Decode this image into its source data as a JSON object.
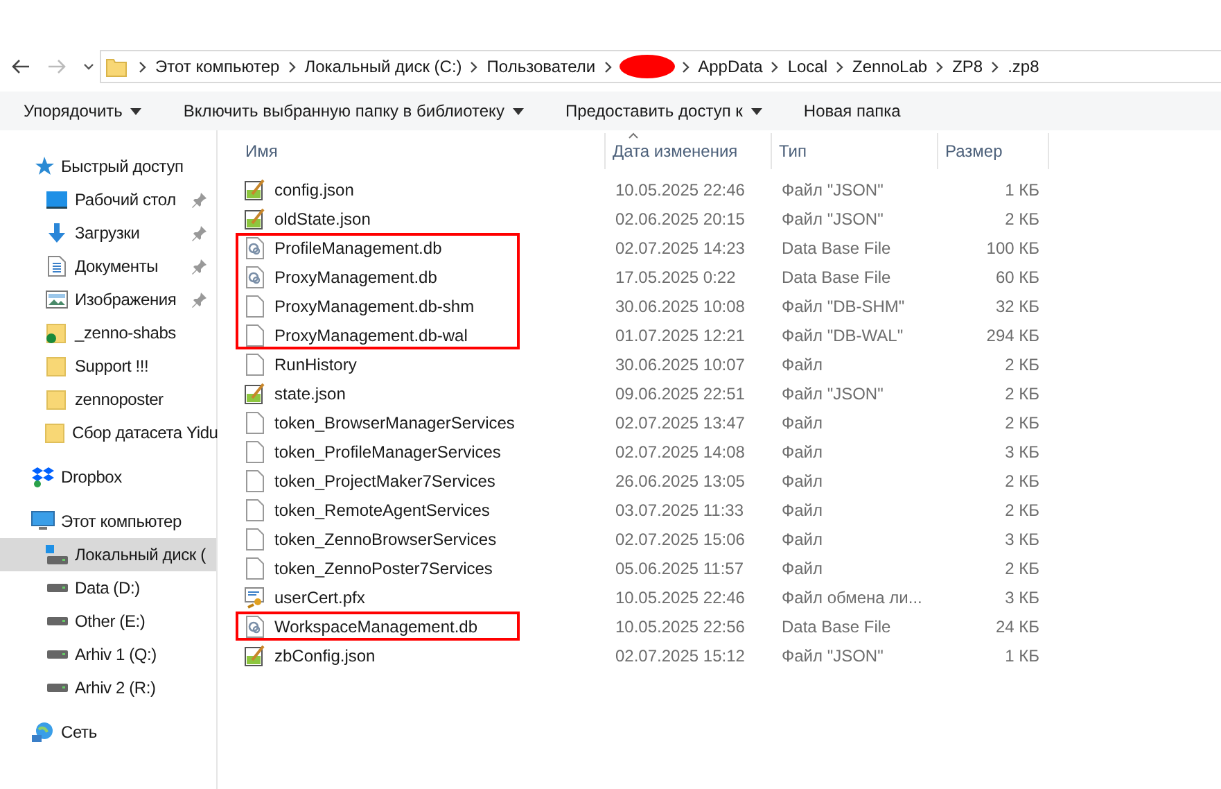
{
  "address_bar": {
    "segments": [
      "Этот компьютер",
      "Локальный диск (C:)",
      "Пользователи",
      {
        "kind": "redacted"
      },
      "AppData",
      "Local",
      "ZennoLab",
      "ZP8",
      ".zp8"
    ]
  },
  "toolbar": [
    {
      "label": "Упорядочить",
      "dropdown": true
    },
    {
      "label": "Включить выбранную папку в библиотеку",
      "dropdown": true
    },
    {
      "label": "Предоставить доступ к",
      "dropdown": true
    },
    {
      "label": "Новая папка",
      "dropdown": false
    }
  ],
  "sidebar": {
    "items": [
      {
        "label": "Быстрый доступ",
        "kind": "star",
        "selected": false,
        "children": [
          {
            "label": "Рабочий стол",
            "kind": "desktop",
            "pinned": true,
            "selected": false
          },
          {
            "label": "Загрузки",
            "kind": "download",
            "pinned": true,
            "selected": false
          },
          {
            "label": "Документы",
            "kind": "document",
            "pinned": true,
            "selected": false
          },
          {
            "label": "Изображения",
            "kind": "pictures",
            "pinned": true,
            "selected": false
          },
          {
            "label": "_zenno-shabs",
            "kind": "synced",
            "pinned": false,
            "selected": false
          },
          {
            "label": "Support !!!",
            "kind": "folder",
            "pinned": false,
            "selected": false
          },
          {
            "label": "zennoposter",
            "kind": "folder",
            "pinned": false,
            "selected": false
          },
          {
            "label": "Сбор датасета Yidu",
            "kind": "folder",
            "pinned": false,
            "selected": false
          }
        ]
      },
      {
        "label": "Dropbox",
        "kind": "dropbox",
        "selected": false
      },
      {
        "label": "Этот компьютер",
        "kind": "computer",
        "selected": false,
        "children": [
          {
            "label": "Локальный диск (",
            "kind": "system",
            "selected": true
          },
          {
            "label": "Data (D:)",
            "kind": "drive",
            "selected": false
          },
          {
            "label": "Other (E:)",
            "kind": "drive",
            "selected": false
          },
          {
            "label": "Arhiv 1 (Q:)",
            "kind": "drive",
            "selected": false
          },
          {
            "label": "Arhiv 2 (R:)",
            "kind": "drive",
            "selected": false
          }
        ]
      },
      {
        "label": "Сеть",
        "kind": "network",
        "selected": false
      }
    ]
  },
  "table": {
    "columns": [
      "Имя",
      "Дата изменения",
      "Тип",
      "Размер"
    ],
    "rows": [
      {
        "name": "config.json",
        "kind": "json",
        "date": "10.05.2025 22:46",
        "type": "Файл \"JSON\"",
        "size": "1 КБ",
        "highlighted": false
      },
      {
        "name": "oldState.json",
        "kind": "json",
        "date": "02.06.2025 20:15",
        "type": "Файл \"JSON\"",
        "size": "2 КБ",
        "highlighted": false
      },
      {
        "name": "ProfileManagement.db",
        "kind": "db",
        "date": "02.07.2025 14:23",
        "type": "Data Base File",
        "size": "100 КБ",
        "highlighted": true
      },
      {
        "name": "ProxyManagement.db",
        "kind": "db",
        "date": "17.05.2025 0:22",
        "type": "Data Base File",
        "size": "60 КБ",
        "highlighted": true
      },
      {
        "name": "ProxyManagement.db-shm",
        "kind": "blank",
        "date": "30.06.2025 10:08",
        "type": "Файл \"DB-SHM\"",
        "size": "32 КБ",
        "highlighted": true
      },
      {
        "name": "ProxyManagement.db-wal",
        "kind": "blank",
        "date": "01.07.2025 12:21",
        "type": "Файл \"DB-WAL\"",
        "size": "294 КБ",
        "highlighted": true
      },
      {
        "name": "RunHistory",
        "kind": "blank",
        "date": "30.06.2025 10:07",
        "type": "Файл",
        "size": "2 КБ",
        "highlighted": false
      },
      {
        "name": "state.json",
        "kind": "json",
        "date": "09.06.2025 22:51",
        "type": "Файл \"JSON\"",
        "size": "2 КБ",
        "highlighted": false
      },
      {
        "name": "token_BrowserManagerServices",
        "kind": "blank",
        "date": "02.07.2025 13:47",
        "type": "Файл",
        "size": "2 КБ",
        "highlighted": false
      },
      {
        "name": "token_ProfileManagerServices",
        "kind": "blank",
        "date": "02.07.2025 14:08",
        "type": "Файл",
        "size": "3 КБ",
        "highlighted": false
      },
      {
        "name": "token_ProjectMaker7Services",
        "kind": "blank",
        "date": "26.06.2025 13:05",
        "type": "Файл",
        "size": "2 КБ",
        "highlighted": false
      },
      {
        "name": "token_RemoteAgentServices",
        "kind": "blank",
        "date": "03.07.2025 11:33",
        "type": "Файл",
        "size": "2 КБ",
        "highlighted": false
      },
      {
        "name": "token_ZennoBrowserServices",
        "kind": "blank",
        "date": "02.07.2025 15:06",
        "type": "Файл",
        "size": "3 КБ",
        "highlighted": false
      },
      {
        "name": "token_ZennoPoster7Services",
        "kind": "blank",
        "date": "05.06.2025 11:57",
        "type": "Файл",
        "size": "2 КБ",
        "highlighted": false
      },
      {
        "name": "userCert.pfx",
        "kind": "cert",
        "date": "10.05.2025 22:46",
        "type": "Файл обмена ли...",
        "size": "3 КБ",
        "highlighted": false
      },
      {
        "name": "WorkspaceManagement.db",
        "kind": "db",
        "date": "10.05.2025 22:56",
        "type": "Data Base File",
        "size": "24 КБ",
        "highlighted": true
      },
      {
        "name": "zbConfig.json",
        "kind": "json",
        "date": "02.07.2025 15:12",
        "type": "Файл \"JSON\"",
        "size": "1 КБ",
        "highlighted": false
      }
    ]
  }
}
